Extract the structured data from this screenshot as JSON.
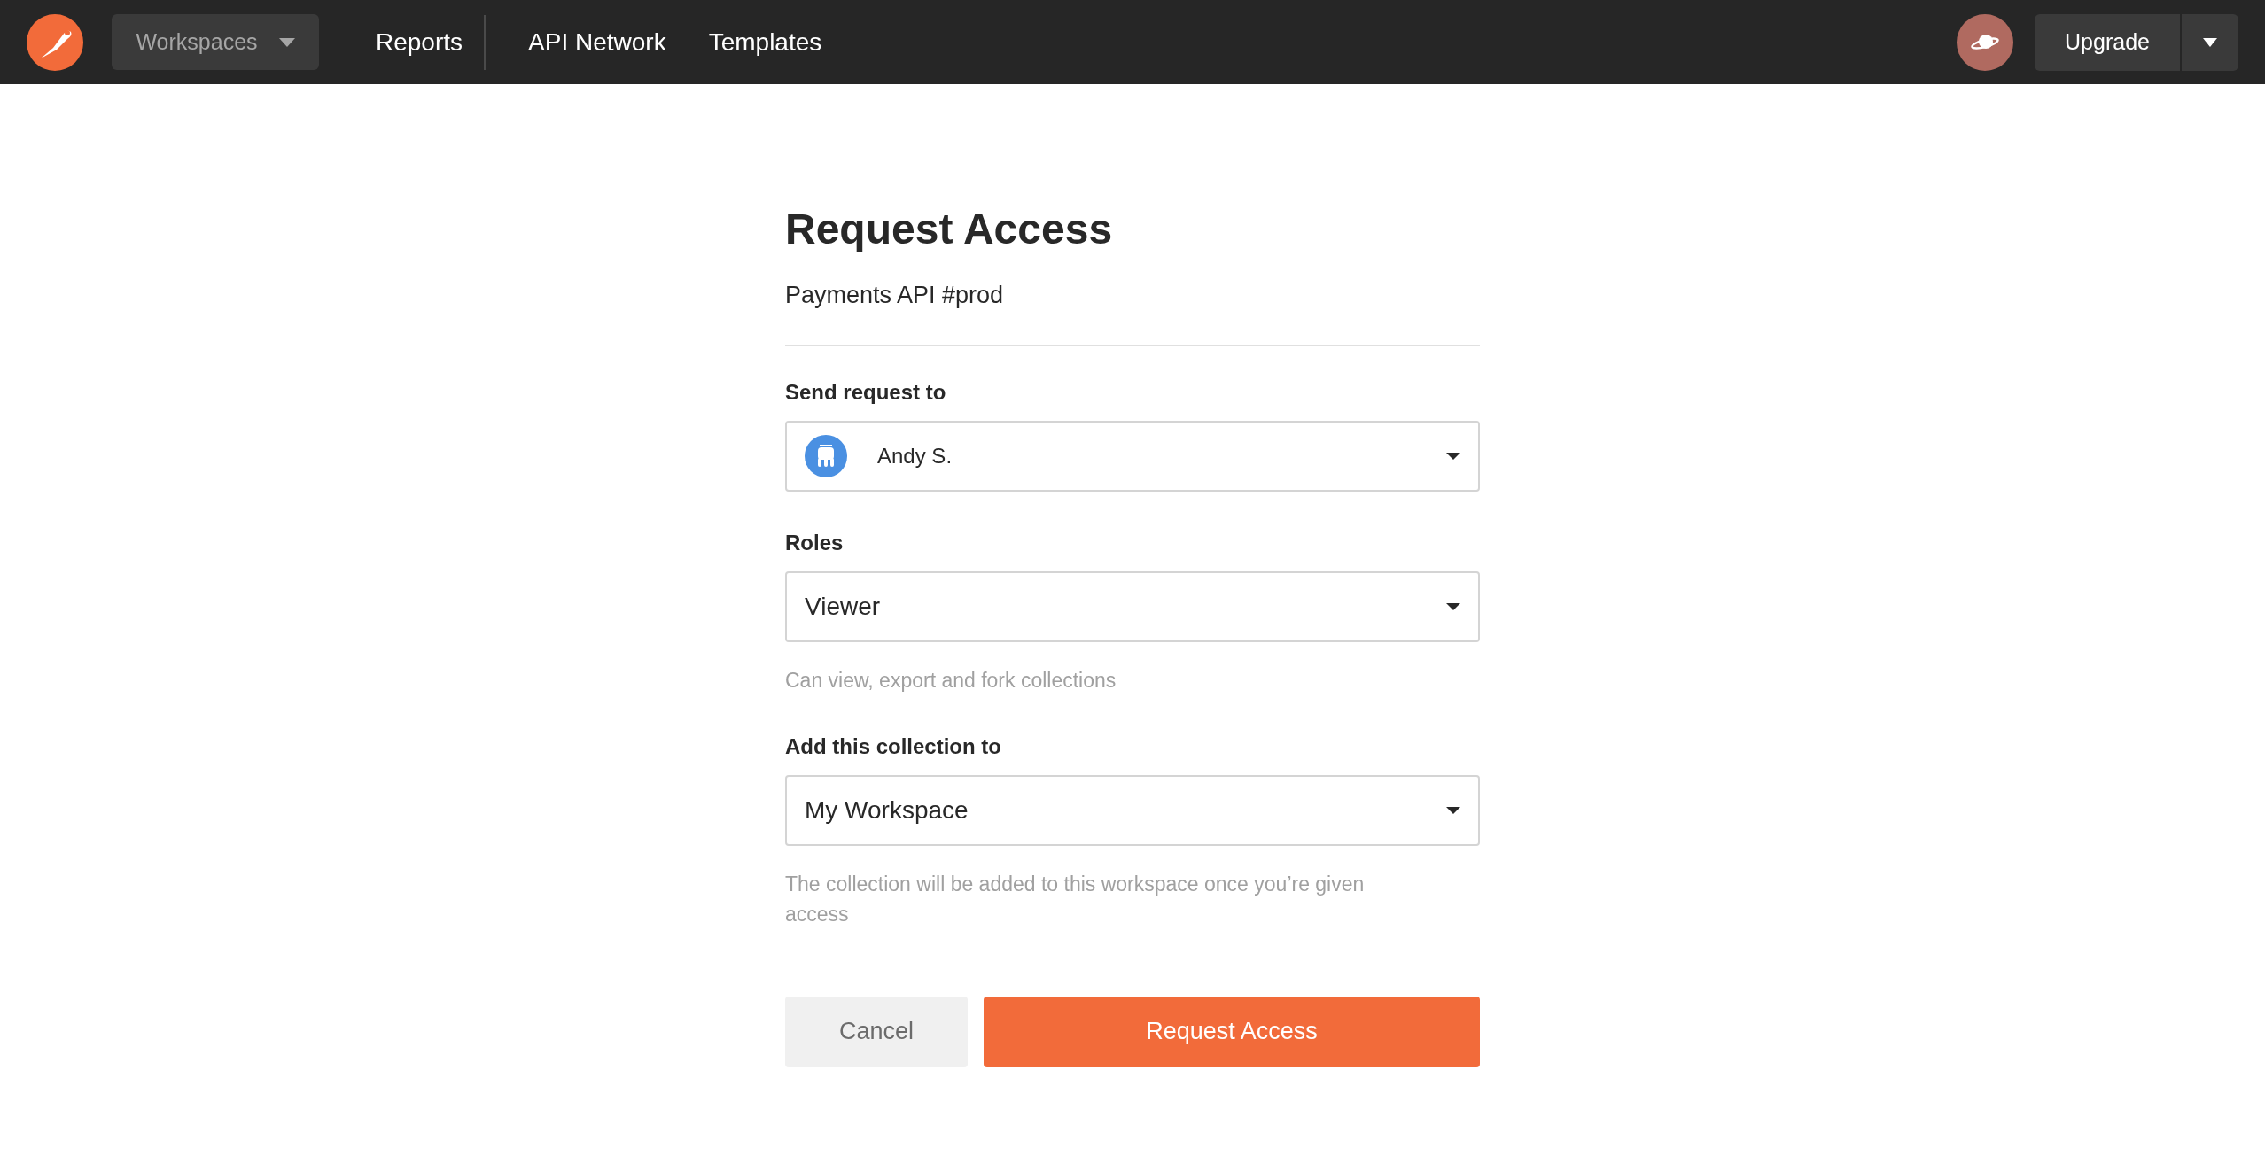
{
  "header": {
    "workspaces": "Workspaces",
    "nav": [
      {
        "label": "Reports",
        "divider_after": true
      },
      {
        "label": "API Network",
        "divider_after": false
      },
      {
        "label": "Templates",
        "divider_after": false
      }
    ],
    "upgrade": "Upgrade"
  },
  "form": {
    "title": "Request Access",
    "subtitle": "Payments API #prod",
    "fields": [
      {
        "kind": "user",
        "label": "Send request to",
        "value": "Andy S."
      },
      {
        "kind": "select",
        "label": "Roles",
        "value": "Viewer",
        "help": "Can view, export and fork collections"
      },
      {
        "kind": "select",
        "label": "Add this collection to",
        "value": "My Workspace",
        "help": "The collection will be added to this workspace once you’re given access"
      }
    ],
    "buttons": {
      "cancel": "Cancel",
      "submit": "Request Access"
    }
  }
}
